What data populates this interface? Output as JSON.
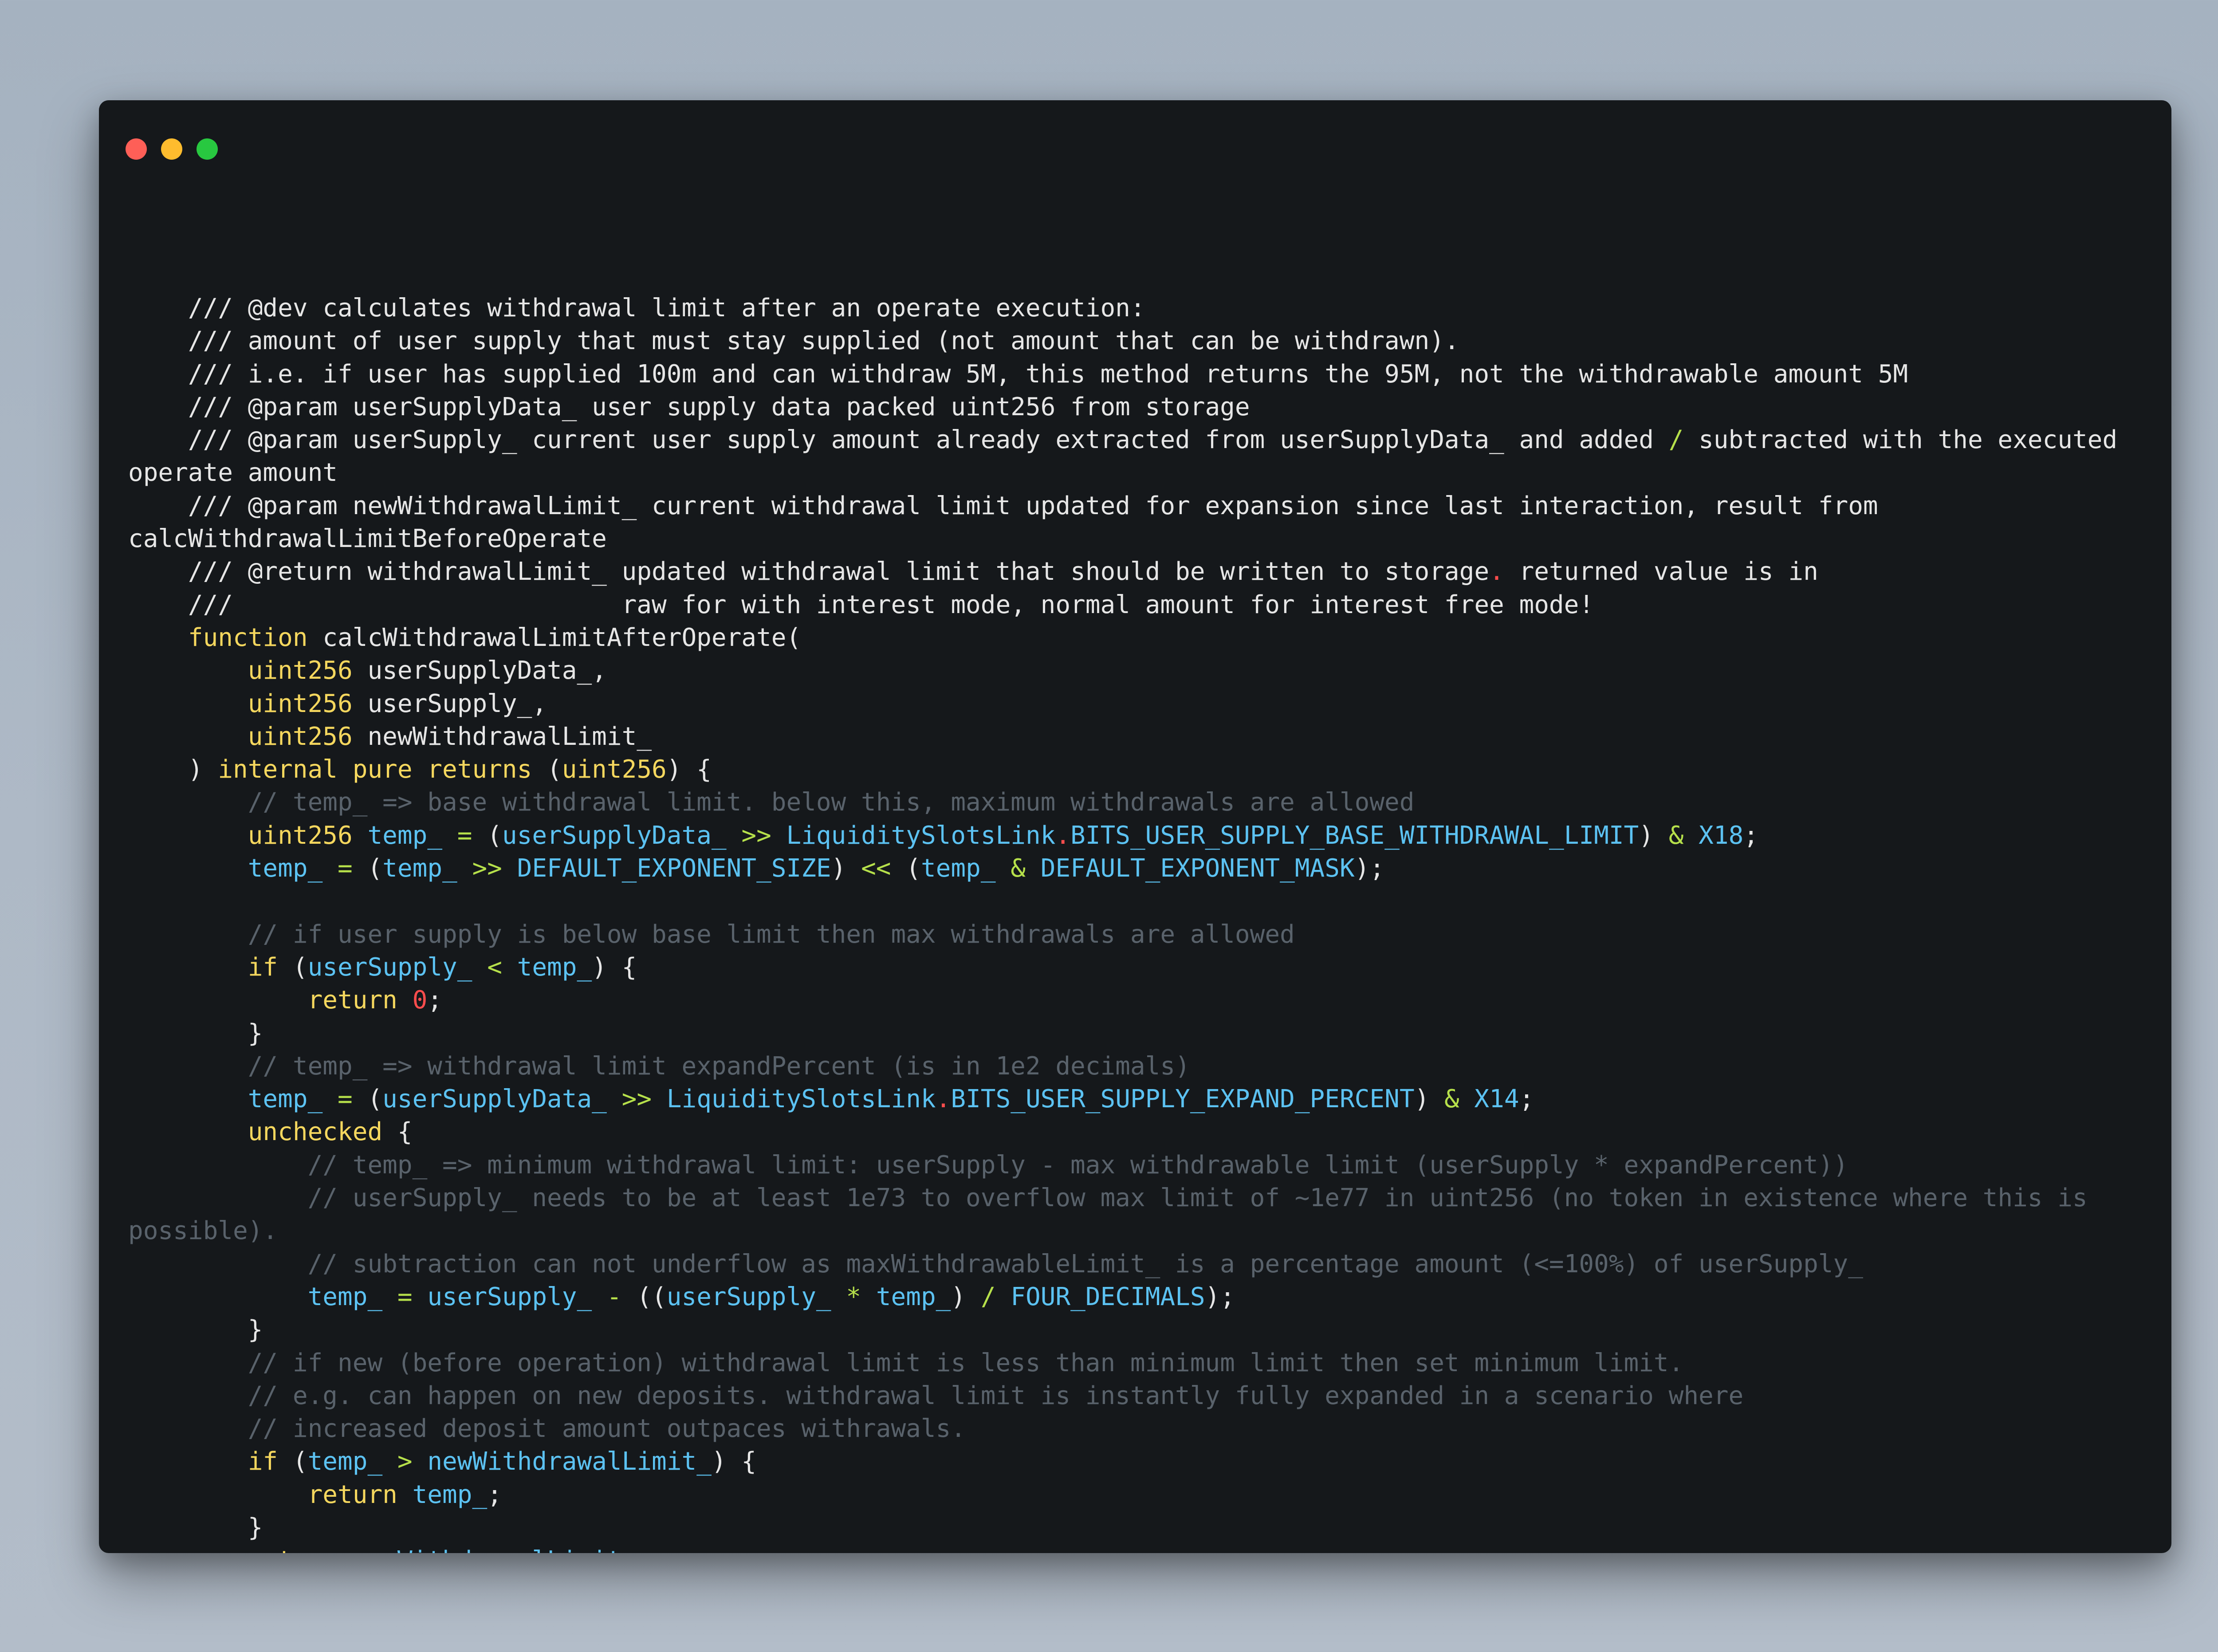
{
  "window": {
    "controls": [
      "close",
      "minimize",
      "zoom"
    ],
    "colors": {
      "close": "#fe5f57",
      "minimize": "#febc2e",
      "zoom": "#28c840",
      "background": "#15181b"
    }
  },
  "code": {
    "lines": [
      [
        [
          "d",
          "    /// @dev calculates withdrawal limit after an operate execution:"
        ]
      ],
      [
        [
          "d",
          "    /// amount of user supply that must stay supplied (not amount that can be withdrawn)."
        ]
      ],
      [
        [
          "d",
          "    /// i.e. if user has supplied 100m and can withdraw 5M, this method returns the 95M, not the withdrawable amount 5M"
        ]
      ],
      [
        [
          "d",
          "    /// @param userSupplyData_ user supply data packed uint256 from storage"
        ]
      ],
      [
        [
          "d",
          "    /// @param userSupply_ current user supply amount already extracted from userSupplyData_ and added "
        ],
        [
          "o",
          "/"
        ],
        [
          "d",
          " subtracted with the executed"
        ]
      ],
      [
        [
          "d",
          "operate amount"
        ]
      ],
      [
        [
          "d",
          "    /// @param newWithdrawalLimit_ current withdrawal limit updated for expansion since last interaction, result from"
        ]
      ],
      [
        [
          "d",
          "calcWithdrawalLimitBeforeOperate"
        ]
      ],
      [
        [
          "d",
          "    /// @return withdrawalLimit_ updated withdrawal limit that should be written to storage"
        ],
        [
          "n",
          "."
        ],
        [
          "d",
          " returned value is in"
        ]
      ],
      [
        [
          "d",
          "    ///                          raw for with interest mode, normal amount for interest free mode!"
        ]
      ],
      [
        [
          "p",
          "    "
        ],
        [
          "k",
          "function"
        ],
        [
          "p",
          " calcWithdrawalLimitAfterOperate("
        ]
      ],
      [
        [
          "p",
          "        "
        ],
        [
          "k",
          "uint256"
        ],
        [
          "p",
          " userSupplyData_,"
        ]
      ],
      [
        [
          "p",
          "        "
        ],
        [
          "k",
          "uint256"
        ],
        [
          "p",
          " userSupply_,"
        ]
      ],
      [
        [
          "p",
          "        "
        ],
        [
          "k",
          "uint256"
        ],
        [
          "p",
          " newWithdrawalLimit_"
        ]
      ],
      [
        [
          "p",
          "    ) "
        ],
        [
          "k",
          "internal pure returns"
        ],
        [
          "p",
          " ("
        ],
        [
          "k",
          "uint256"
        ],
        [
          "p",
          ") {"
        ]
      ],
      [
        [
          "c",
          "        // temp_ => base withdrawal limit. below this, maximum withdrawals are allowed"
        ]
      ],
      [
        [
          "p",
          "        "
        ],
        [
          "k",
          "uint256"
        ],
        [
          "p",
          " "
        ],
        [
          "i",
          "temp_"
        ],
        [
          "p",
          " "
        ],
        [
          "o",
          "="
        ],
        [
          "p",
          " ("
        ],
        [
          "i",
          "userSupplyData_"
        ],
        [
          "p",
          " "
        ],
        [
          "o",
          ">>"
        ],
        [
          "p",
          " "
        ],
        [
          "i",
          "LiquiditySlotsLink"
        ],
        [
          "n",
          "."
        ],
        [
          "i",
          "BITS_USER_SUPPLY_BASE_WITHDRAWAL_LIMIT"
        ],
        [
          "p",
          ") "
        ],
        [
          "o",
          "&"
        ],
        [
          "p",
          " "
        ],
        [
          "i",
          "X18"
        ],
        [
          "p",
          ";"
        ]
      ],
      [
        [
          "p",
          "        "
        ],
        [
          "i",
          "temp_"
        ],
        [
          "p",
          " "
        ],
        [
          "o",
          "="
        ],
        [
          "p",
          " ("
        ],
        [
          "i",
          "temp_"
        ],
        [
          "p",
          " "
        ],
        [
          "o",
          ">>"
        ],
        [
          "p",
          " "
        ],
        [
          "i",
          "DEFAULT_EXPONENT_SIZE"
        ],
        [
          "p",
          ") "
        ],
        [
          "o",
          "<<"
        ],
        [
          "p",
          " ("
        ],
        [
          "i",
          "temp_"
        ],
        [
          "p",
          " "
        ],
        [
          "o",
          "&"
        ],
        [
          "p",
          " "
        ],
        [
          "i",
          "DEFAULT_EXPONENT_MASK"
        ],
        [
          "p",
          ");"
        ]
      ],
      [
        [
          "p",
          ""
        ]
      ],
      [
        [
          "c",
          "        // if user supply is below base limit then max withdrawals are allowed"
        ]
      ],
      [
        [
          "p",
          "        "
        ],
        [
          "k",
          "if"
        ],
        [
          "p",
          " ("
        ],
        [
          "i",
          "userSupply_"
        ],
        [
          "p",
          " "
        ],
        [
          "o",
          "<"
        ],
        [
          "p",
          " "
        ],
        [
          "i",
          "temp_"
        ],
        [
          "p",
          ") {"
        ]
      ],
      [
        [
          "p",
          "            "
        ],
        [
          "k",
          "return"
        ],
        [
          "p",
          " "
        ],
        [
          "n",
          "0"
        ],
        [
          "p",
          ";"
        ]
      ],
      [
        [
          "p",
          "        }"
        ]
      ],
      [
        [
          "c",
          "        // temp_ => withdrawal limit expandPercent (is in 1e2 decimals)"
        ]
      ],
      [
        [
          "p",
          "        "
        ],
        [
          "i",
          "temp_"
        ],
        [
          "p",
          " "
        ],
        [
          "o",
          "="
        ],
        [
          "p",
          " ("
        ],
        [
          "i",
          "userSupplyData_"
        ],
        [
          "p",
          " "
        ],
        [
          "o",
          ">>"
        ],
        [
          "p",
          " "
        ],
        [
          "i",
          "LiquiditySlotsLink"
        ],
        [
          "n",
          "."
        ],
        [
          "i",
          "BITS_USER_SUPPLY_EXPAND_PERCENT"
        ],
        [
          "p",
          ") "
        ],
        [
          "o",
          "&"
        ],
        [
          "p",
          " "
        ],
        [
          "i",
          "X14"
        ],
        [
          "p",
          ";"
        ]
      ],
      [
        [
          "p",
          "        "
        ],
        [
          "k",
          "unchecked"
        ],
        [
          "p",
          " {"
        ]
      ],
      [
        [
          "c",
          "            // temp_ => minimum withdrawal limit: userSupply - max withdrawable limit (userSupply * expandPercent))"
        ]
      ],
      [
        [
          "c",
          "            // userSupply_ needs to be at least 1e73 to overflow max limit of ~1e77 in uint256 (no token in existence where this is"
        ]
      ],
      [
        [
          "c",
          "possible)."
        ]
      ],
      [
        [
          "c",
          "            // subtraction can not underflow as maxWithdrawableLimit_ is a percentage amount (<=100%) of userSupply_"
        ]
      ],
      [
        [
          "p",
          "            "
        ],
        [
          "i",
          "temp_"
        ],
        [
          "p",
          " "
        ],
        [
          "o",
          "="
        ],
        [
          "p",
          " "
        ],
        [
          "i",
          "userSupply_"
        ],
        [
          "p",
          " "
        ],
        [
          "o",
          "-"
        ],
        [
          "p",
          " (("
        ],
        [
          "i",
          "userSupply_"
        ],
        [
          "p",
          " "
        ],
        [
          "o",
          "*"
        ],
        [
          "p",
          " "
        ],
        [
          "i",
          "temp_"
        ],
        [
          "p",
          ") "
        ],
        [
          "o",
          "/"
        ],
        [
          "p",
          " "
        ],
        [
          "i",
          "FOUR_DECIMALS"
        ],
        [
          "p",
          ");"
        ]
      ],
      [
        [
          "p",
          "        }"
        ]
      ],
      [
        [
          "c",
          "        // if new (before operation) withdrawal limit is less than minimum limit then set minimum limit."
        ]
      ],
      [
        [
          "c",
          "        // e.g. can happen on new deposits. withdrawal limit is instantly fully expanded in a scenario where"
        ]
      ],
      [
        [
          "c",
          "        // increased deposit amount outpaces withrawals."
        ]
      ],
      [
        [
          "p",
          "        "
        ],
        [
          "k",
          "if"
        ],
        [
          "p",
          " ("
        ],
        [
          "i",
          "temp_"
        ],
        [
          "p",
          " "
        ],
        [
          "o",
          ">"
        ],
        [
          "p",
          " "
        ],
        [
          "i",
          "newWithdrawalLimit_"
        ],
        [
          "p",
          ") {"
        ]
      ],
      [
        [
          "p",
          "            "
        ],
        [
          "k",
          "return"
        ],
        [
          "p",
          " "
        ],
        [
          "i",
          "temp_"
        ],
        [
          "p",
          ";"
        ]
      ],
      [
        [
          "p",
          "        }"
        ]
      ],
      [
        [
          "p",
          "        "
        ],
        [
          "k",
          "return"
        ],
        [
          "p",
          " "
        ],
        [
          "i",
          "newWithdrawalLimit_"
        ],
        [
          "p",
          ";"
        ]
      ],
      [
        [
          "p",
          "    }"
        ]
      ]
    ]
  }
}
